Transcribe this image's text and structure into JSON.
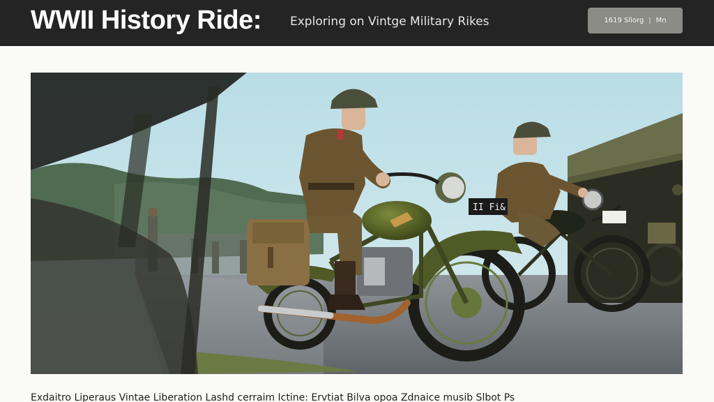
{
  "header": {
    "title": "WWII History Ride:",
    "subtitle": "Exploring on Vintge Military Rikes",
    "button": {
      "left_label": "1619 Sllorg",
      "right_label": "Mn"
    }
  },
  "hero": {
    "motorcycle_plate": "II Fi&"
  },
  "caption": {
    "text": "Exdaitro Liperaus Vintae Liberation Lashd cerraim Ictine: Ervtiat Bilva opoa Zdnaice musib Slbot Ps"
  },
  "colors": {
    "header_bg": "#242424",
    "button_bg": "#8c8c86",
    "uniform": "#6b5530",
    "bike_olive": "#4f5a26"
  }
}
